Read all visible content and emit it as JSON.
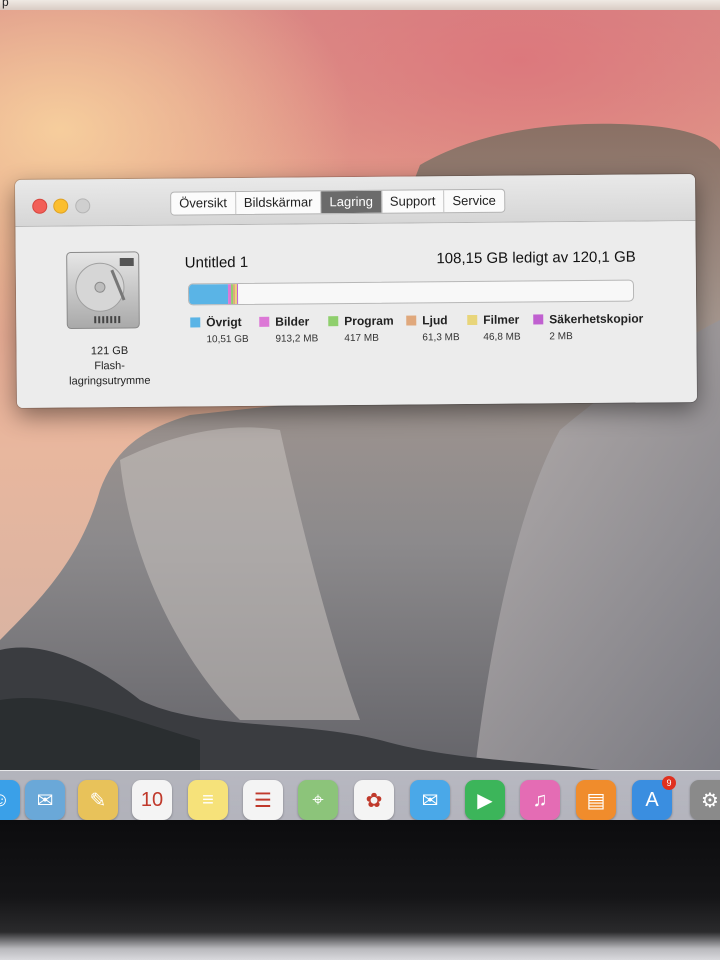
{
  "menu_fragment": "p",
  "window": {
    "tabs": [
      {
        "label": "Översikt",
        "active": false
      },
      {
        "label": "Bildskärmar",
        "active": false
      },
      {
        "label": "Lagring",
        "active": true
      },
      {
        "label": "Support",
        "active": false
      },
      {
        "label": "Service",
        "active": false
      }
    ],
    "disk": {
      "capacity": "121 GB",
      "type_line1": "Flash-",
      "type_line2": "lagringsutrymme",
      "name": "Untitled 1",
      "free_text": "108,15 GB ledigt av 120,1 GB"
    },
    "storage": {
      "total_gb": 120.1,
      "categories": [
        {
          "name": "Övrigt",
          "size": "10,51 GB",
          "gb": 10.51,
          "color": "#5ab4e6"
        },
        {
          "name": "Bilder",
          "size": "913,2 MB",
          "gb": 0.913,
          "color": "#dc78d6"
        },
        {
          "name": "Program",
          "size": "417 MB",
          "gb": 0.417,
          "color": "#8fcf6d"
        },
        {
          "name": "Ljud",
          "size": "61,3 MB",
          "gb": 0.061,
          "color": "#e0a87c"
        },
        {
          "name": "Filmer",
          "size": "46,8 MB",
          "gb": 0.047,
          "color": "#e8d57a"
        },
        {
          "name": "Säkerhetskopior",
          "size": "2 MB",
          "gb": 0.002,
          "color": "#c060d0"
        }
      ]
    }
  },
  "dock": {
    "items": [
      {
        "name": "finder-icon",
        "glyph": "☺",
        "color": "#3aa0e8"
      },
      {
        "name": "preview-icon",
        "glyph": "✉",
        "color": "#6aa8d8"
      },
      {
        "name": "notes-icon",
        "glyph": "✎",
        "color": "#e8c25a"
      },
      {
        "name": "calendar-icon",
        "glyph": "10",
        "color": "#f4f4f4"
      },
      {
        "name": "stickies-icon",
        "glyph": "≡",
        "color": "#f6e27a"
      },
      {
        "name": "reminders-icon",
        "glyph": "☰",
        "color": "#f4f4f4"
      },
      {
        "name": "maps-icon",
        "glyph": "⌖",
        "color": "#8cc47a"
      },
      {
        "name": "photos-icon",
        "glyph": "✿",
        "color": "#f4f4f4"
      },
      {
        "name": "messages-icon",
        "glyph": "✉",
        "color": "#4aa8e8"
      },
      {
        "name": "facetime-icon",
        "glyph": "▶",
        "color": "#3cb55a"
      },
      {
        "name": "itunes-icon",
        "glyph": "♫",
        "color": "#e46cb4"
      },
      {
        "name": "ibooks-icon",
        "glyph": "▤",
        "color": "#f08c2c"
      },
      {
        "name": "app-store-icon",
        "glyph": "A",
        "color": "#3a8ee0",
        "badge": "9"
      },
      {
        "name": "system-preferences-icon",
        "glyph": "⚙",
        "color": "#8a8a8a"
      }
    ]
  }
}
